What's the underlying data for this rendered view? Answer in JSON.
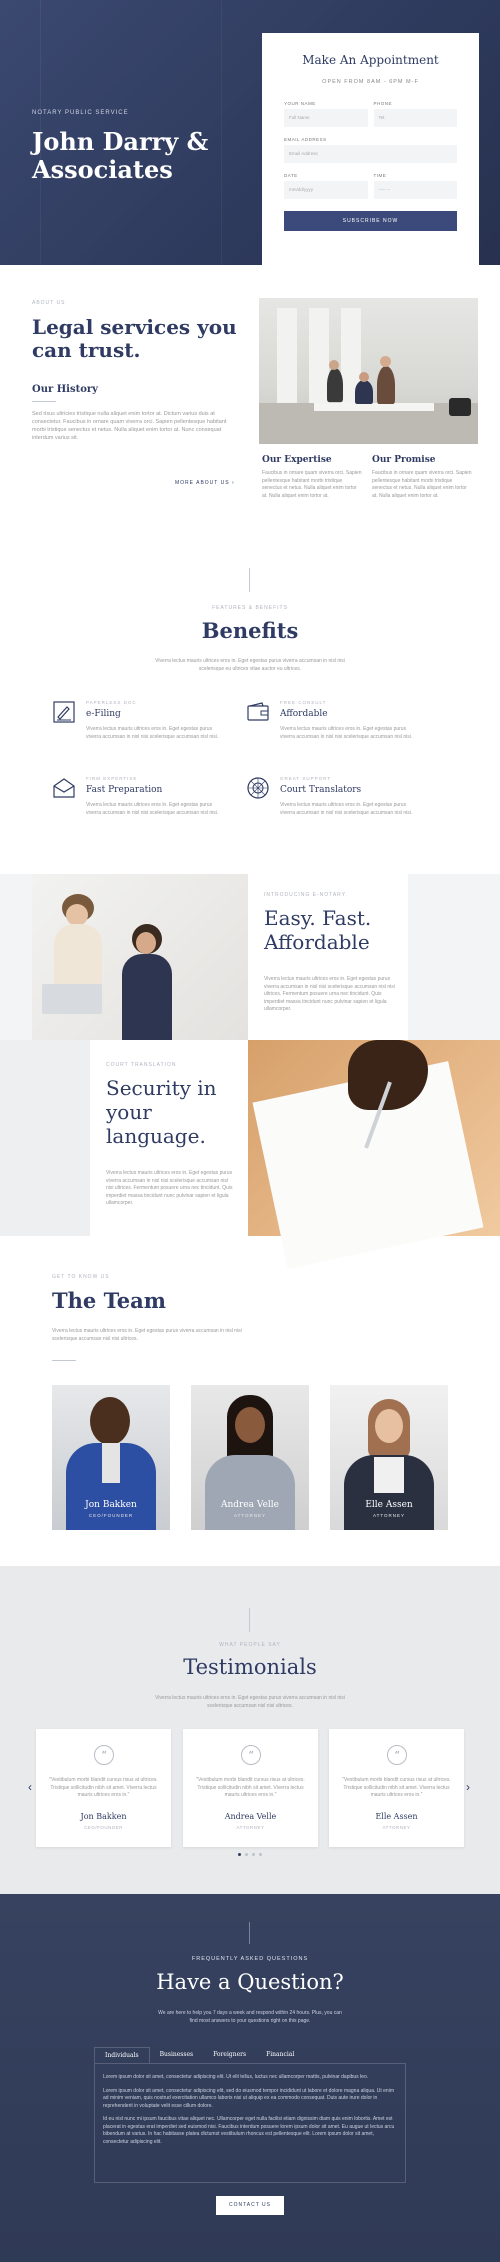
{
  "hero": {
    "eyebrow": "NOTARY PUBLIC SERVICE",
    "title": "John Darry & Associates"
  },
  "appointment": {
    "title": "Make An Appointment",
    "subtitle": "OPEN FROM 8AM - 6PM M-F",
    "fields": [
      {
        "label": "YOUR NAME",
        "placeholder": "Full Name"
      },
      {
        "label": "PHONE",
        "placeholder": "Tel."
      },
      {
        "label": "EMAIL ADDRESS",
        "placeholder": "Email Address"
      },
      {
        "label": "DATE",
        "placeholder": "mm/dd/yyyy"
      },
      {
        "label": "TIME",
        "placeholder": "--:-- --"
      }
    ],
    "button": "SUBSCRIBE NOW"
  },
  "about": {
    "eyebrow": "ABOUT US",
    "title": "Legal services you can trust.",
    "history_title": "Our History",
    "history_text": "Sed risus ultricies tristique nulla aliquet enim tortor at. Dictum varius duis at consectetur. Faucibus in ornare quam viverra orci. Sapien pellentesque habitant morbi tristique senectus et netus. Nulla aliquet enim tortor at. Nunc consequat interdum varius sit.",
    "more": "MORE ABOUT US",
    "expertise_title": "Our Expertise",
    "expertise_text": "Faucibus in ornare quam viverra orci. Sapien pellentesque habitant morbi tristique senectus et netus. Nulla aliquet enim tortor at. Nulla aliquet enim tortor at.",
    "promise_title": "Our Promise",
    "promise_text": "Faucibus in ornare quam viverra orci. Sapien pellentesque habitant morbi tristique senectus et netus. Nulla aliquet enim tortor at. Nulla aliquet enim tortor at."
  },
  "benefits": {
    "eyebrow": "FEATURES & BENEFITS",
    "title": "Benefits",
    "subtitle": "Viverra lectus mauris ultrices eros in. Eget egestas purus viverra accumsan in nisl nisi scelerisque eu ultrices vitae auctor eu ultrices.",
    "items": [
      {
        "eyebrow": "PAPERLESS DOC",
        "title": "e-Filing",
        "icon": "signature-icon",
        "text": "Viverra lectus mauris ultrices eros in. Eget egestas purus viverra accumsan in nisl nisi scelerisque accumsan nisl nisi."
      },
      {
        "eyebrow": "FREE CONSULT",
        "title": "Affordable",
        "icon": "wallet-icon",
        "text": "Viverra lectus mauris ultrices eros in. Eget egestas purus viverra accumsan in nisl nisi scelerisque accumsan nisl nisi."
      },
      {
        "eyebrow": "FIRM EXPERTISE",
        "title": "Fast Preparation",
        "icon": "envelope-icon",
        "text": "Viverra lectus mauris ultrices eros in. Eget egestas purus viverra accumsan in nisl nisi scelerisque accumsan nisl nisi."
      },
      {
        "eyebrow": "GREAT SUPPORT",
        "title": "Court Translators",
        "icon": "globe-icon",
        "text": "Viverra lectus mauris ultrices eros in. Eget egestas purus viverra accumsan in nisl nisi scelerisque accumsan nisl nisi."
      }
    ]
  },
  "features": {
    "easy": {
      "eyebrow": "INTRODUCING E-NOTARY",
      "title": "Easy. Fast. Affordable",
      "text": "Viverra lectus mauris ultrices eros in. Eget egestas purus viverra accumsan in nisl nisi scelerisque accumsan nisl nisi ultrices. Fermentum posuere urna nec tincidunt. Quis imperdiet massa tincidunt nunc pulvinar sapien et ligula ullamcorper."
    },
    "security": {
      "eyebrow": "COURT TRANSLATION",
      "title": "Security in your language.",
      "text": "Viverra lectus mauris ultrices eros in. Eget egestas purus viverra accumsan in nisl nisi scelerisque accumsan nisl nisi ultrices. Fermentum posuere urna nec tincidunt. Quis imperdiet massa tincidunt nunc pulvinar sapien et ligula ullamcorper."
    }
  },
  "team": {
    "eyebrow": "GET TO KNOW US",
    "title": "The Team",
    "subtitle": "Viverra lectus mauris ultrices eros in. Eget egestas purus viverra accumsan in nisl nisi scelerisque accumsan nisl nisi ultrices.",
    "members": [
      {
        "name": "Jon Bakken",
        "role": "CEO/FOUNDER"
      },
      {
        "name": "Andrea Velle",
        "role": "ATTORNEY"
      },
      {
        "name": "Elle Assen",
        "role": "ATTORNEY"
      }
    ]
  },
  "testimonials": {
    "eyebrow": "WHAT PEOPLE SAY",
    "title": "Testimonials",
    "subtitle": "Viverra lectus mauris ultrices eros in. Eget egestas purus viverra accumsan in nisl nisi scelerisque accumsan nisl nisi ultrices.",
    "items": [
      {
        "text": "\"Vestibulum morbi blandit cursus risus at ultrices. Tristique sollicitudin nibh sit amet. Viverra lectus mauris ultrices eros in.\"",
        "name": "Jon Bakken",
        "role": "CEO/FOUNDER"
      },
      {
        "text": "\"Vestibulum morbi blandit cursus risus at ultrices. Tristique sollicitudin nibh sit amet. Viverra lectus mauris ultrices eros in.\"",
        "name": "Andrea Velle",
        "role": "ATTORNEY"
      },
      {
        "text": "\"Vestibulum morbi blandit cursus risus at ultrices. Tristique sollicitudin nibh sit amet. Viverra lectus mauris ultrices eros in.\"",
        "name": "Elle Assen",
        "role": "ATTORNEY"
      }
    ],
    "prev": "‹",
    "next": "›"
  },
  "faq": {
    "eyebrow": "FREQUENTLY ASKED QUESTIONS",
    "title": "Have a Question?",
    "subtitle": "We are here to help you 7 days a week and respond within 24 hours. Plus, you can find most answers to your questions right on this page.",
    "tabs": [
      "Individuals",
      "Businesses",
      "Foreigners",
      "Financial"
    ],
    "paragraphs": [
      "Lorem ipsum dolor sit amet, consectetur adipiscing elit. Ut elit tellus, luctus nec ullamcorper mattis, pulvinar dapibus leo.",
      "Lorem ipsum dolor sit amet, consectetur adipiscing elit, sed do eiusmod tempor incididunt ut labore et dolore magna aliqua. Ut enim ad minim veniam, quis nostrud exercitation ullamco laboris nisi ut aliquip ex ea commodo consequat. Duis aute irure dolor in reprehenderit in voluptate velit esse cillum dolore.",
      "Id eu nisl nunc mi ipsum faucibus vitae aliquet nec. Ullamcorper eget nulla facilisi etiam dignissim diam quis enim lobortis. Amet est placerat in egestas erat imperdiet sed euismod nisi. Faucibus interdum posuere lorem ipsum dolor sit amet. Eu augue ut lectus arcu bibendum at varius. In hac habitasse platea dictumst vestibulum rhoncus est pellentesque elit. Lorem ipsum dolor sit amet, consectetur adipiscing elit."
    ],
    "button": "CONTACT US"
  },
  "colors": {
    "navy": "#2f3b63",
    "button": "#3b4a7a",
    "muted": "#9aa0b0"
  }
}
